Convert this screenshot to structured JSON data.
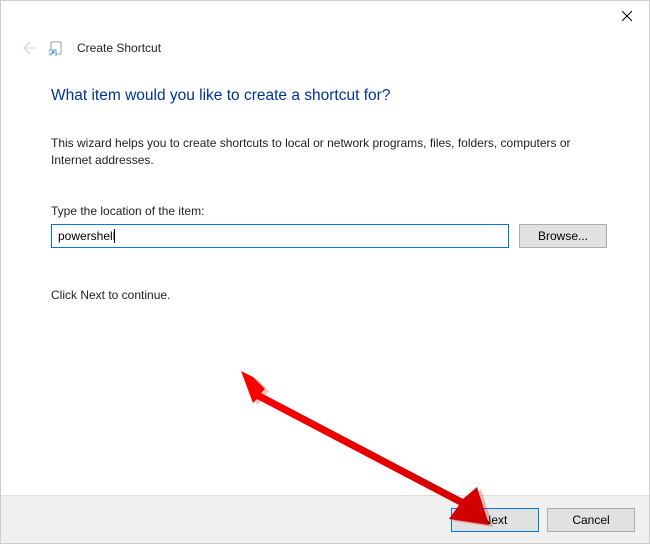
{
  "window": {
    "dialog_name": "Create Shortcut"
  },
  "page": {
    "title": "What item would you like to create a shortcut for?",
    "description": "This wizard helps you to create shortcuts to local or network programs, files, folders, computers or Internet addresses.",
    "input_label": "Type the location of the item:",
    "input_value": "powershell",
    "browse_label": "Browse...",
    "continue_hint": "Click Next to continue."
  },
  "footer": {
    "next_label": "Next",
    "cancel_label": "Cancel"
  }
}
